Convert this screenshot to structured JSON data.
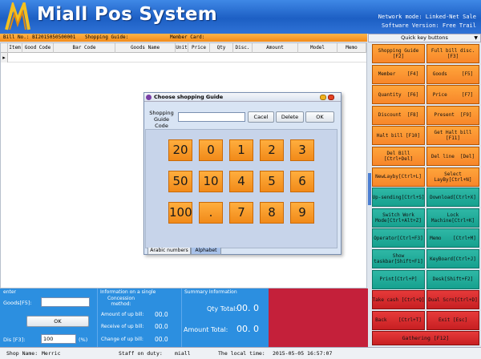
{
  "app": {
    "title": "Miall Pos System",
    "network_mode": "Network mode: Linked-Net Sale",
    "software_version": "Software Version: Free Trail"
  },
  "billbar": {
    "bill_no": "Bill No.: BI2015050500001",
    "shopping_guide": "Shopping Guide:",
    "member_card": "Member Card:"
  },
  "quick_keys": {
    "header": "Quick key buttons",
    "buttons": [
      {
        "label": "Shopping Guide\n[F2]",
        "color": "orange"
      },
      {
        "label": "Full bill disc.\n[F3]",
        "color": "orange"
      },
      {
        "label": "Member    [F4]",
        "color": "orange"
      },
      {
        "label": "Goods     [F5]",
        "color": "orange"
      },
      {
        "label": "Quantity  [F6]",
        "color": "orange"
      },
      {
        "label": "Price     [F7]",
        "color": "orange"
      },
      {
        "label": "Discount  [F8]",
        "color": "orange"
      },
      {
        "label": "Present  [F9]",
        "color": "orange"
      },
      {
        "label": "Halt bill [F10]",
        "color": "orange"
      },
      {
        "label": "Get Halt bill\n[F11]",
        "color": "orange"
      },
      {
        "label": "Del Bill\n[Ctrl+Del]",
        "color": "orange"
      },
      {
        "label": "Del line  [Del]",
        "color": "orange"
      },
      {
        "label": "NewLayby[Ctrl+L]",
        "color": "orange"
      },
      {
        "label": "Select\nLayBy[Ctrl+N]",
        "color": "orange"
      },
      {
        "label": "Up-sending[Ctrl+S]",
        "color": "teal"
      },
      {
        "label": "Download[Ctrl+X]",
        "color": "teal"
      },
      {
        "label": "Switch Work\nMode[Ctrl+Alt+Z]",
        "color": "teal"
      },
      {
        "label": "Lock\nMachine[Ctrl+K]",
        "color": "teal"
      },
      {
        "label": "Operator[Ctrl+F3]",
        "color": "teal"
      },
      {
        "label": "Memo    [Ctrl+M]",
        "color": "teal"
      },
      {
        "label": "Show\ntaskbar[Shift+F1]",
        "color": "teal"
      },
      {
        "label": "KeyBoard[Ctrl+J]",
        "color": "teal"
      },
      {
        "label": "Print[Ctrl+P]",
        "color": "teal"
      },
      {
        "label": "Desk[Shift+F2]",
        "color": "teal"
      },
      {
        "label": "Take cash [Ctrl+Q]",
        "color": "red"
      },
      {
        "label": "Dual Scrn[Ctrl+D]",
        "color": "red"
      },
      {
        "label": "Back    [Ctrl+T]",
        "color": "red"
      },
      {
        "label": "Exit [Esc]",
        "color": "red"
      }
    ],
    "wide_button": "Gathering [F12]"
  },
  "table": {
    "columns": [
      "Item",
      "Good Code",
      "Bar Code",
      "Goods Name",
      "Unit",
      "Price",
      "Qty",
      "Disc.",
      "Amount",
      "Model",
      "Memo"
    ]
  },
  "dialog": {
    "title": "Choose shopping Guide",
    "code_label": "Shopping\nGuide Code",
    "code_value": "",
    "cancel": "Cacel",
    "delete": "Delete",
    "ok": "OK",
    "keypad": [
      "20",
      "0",
      "1",
      "2",
      "3",
      "50",
      "10",
      "4",
      "5",
      "6",
      "100",
      ".",
      "7",
      "8",
      "9"
    ],
    "tabs": [
      "Arabic numbers",
      "Alphabet"
    ]
  },
  "bottom": {
    "enter_label": "enter",
    "goods_label": "Goods[F5]:",
    "goods_value": "",
    "ok": "OK",
    "dis_label": "Dis  [F3]:",
    "dis_value": "100",
    "dis_unit": "(%)",
    "single_title": "Information on a single",
    "concession_label": "Concession\nmethod:",
    "amount_label": "Amount of up bill:",
    "amount_value": "00.0",
    "receive_label": "Receive of up bill:",
    "receive_value": "00.0",
    "change_label": "Change of up bill:",
    "change_value": "00.0",
    "summary_title": "Summary Information",
    "qty_label": "Qty Total:",
    "qty_value": "00. 0",
    "amt_label": "Amount Total:",
    "amt_value": "00. 0"
  },
  "status": {
    "shop_label": "Shop Name:",
    "shop_value": "Merric",
    "staff_label": "Staff on duty:",
    "staff_value": "miall",
    "time_label": "The local time:",
    "time_value": "2015-05-05 16:57:07"
  }
}
